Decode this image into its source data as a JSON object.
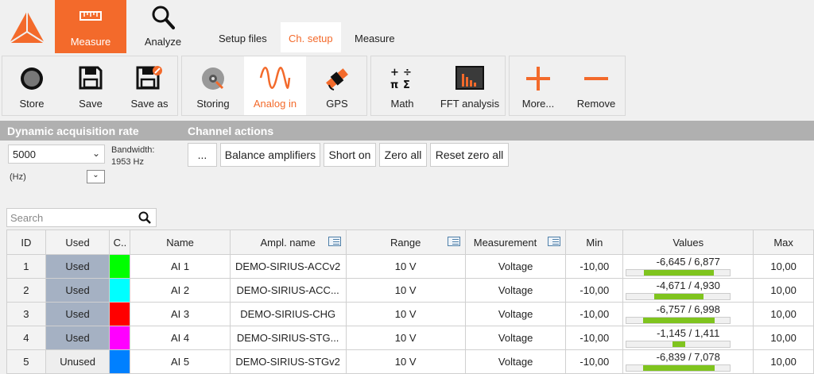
{
  "colors": {
    "accent": "#f36a2b",
    "used_cell": "#a5b1c3",
    "bar_green": "#7fc41e",
    "header_grey": "#b0b0b0"
  },
  "top": {
    "modes": [
      {
        "label": "Measure",
        "icon": "ruler-icon"
      },
      {
        "label": "Analyze",
        "icon": "magnifier-icon"
      }
    ],
    "subtabs": [
      {
        "label": "Setup files"
      },
      {
        "label": "Ch. setup"
      },
      {
        "label": "Measure"
      }
    ]
  },
  "ribbon": {
    "items": [
      {
        "label": "Store",
        "icon": "record-icon"
      },
      {
        "label": "Save",
        "icon": "floppy-icon"
      },
      {
        "label": "Save as",
        "icon": "floppy-edit-icon"
      },
      {
        "label": "Storing",
        "icon": "disk-icon"
      },
      {
        "label": "Analog in",
        "icon": "sine-wave-icon"
      },
      {
        "label": "GPS",
        "icon": "satellite-icon"
      },
      {
        "label": "Math",
        "icon": "math-icon"
      },
      {
        "label": "FFT analysis",
        "icon": "fft-icon"
      },
      {
        "label": "More...",
        "icon": "plus-icon"
      },
      {
        "label": "Remove",
        "icon": "minus-icon"
      }
    ]
  },
  "acquisition": {
    "title": "Dynamic acquisition rate",
    "rate": "5000",
    "unit": "(Hz)",
    "bandwidth_label": "Bandwidth:",
    "bandwidth_value": "1953 Hz"
  },
  "channel_actions": {
    "title": "Channel actions",
    "buttons": [
      "...",
      "Balance amplifiers",
      "Short on",
      "Zero all",
      "Reset zero all"
    ]
  },
  "search": {
    "placeholder": "Search"
  },
  "table": {
    "headers": [
      "ID",
      "Used",
      "C..",
      "Name",
      "Ampl. name",
      "Range",
      "Measurement",
      "Min",
      "Values",
      "Max"
    ],
    "rows": [
      {
        "id": "1",
        "used": "Used",
        "color": "#00ff00",
        "name": "AI 1",
        "ampl": "DEMO-SIRIUS-ACCv2",
        "range": "10 V",
        "measurement": "Voltage",
        "min": "-10,00",
        "values": "-6,645 / 6,877",
        "bar_from": -6.645,
        "bar_to": 6.877,
        "max": "10,00"
      },
      {
        "id": "2",
        "used": "Used",
        "color": "#00ffff",
        "name": "AI 2",
        "ampl": "DEMO-SIRIUS-ACC...",
        "range": "10 V",
        "measurement": "Voltage",
        "min": "-10,00",
        "values": "-4,671 / 4,930",
        "bar_from": -4.671,
        "bar_to": 4.93,
        "max": "10,00"
      },
      {
        "id": "3",
        "used": "Used",
        "color": "#ff0000",
        "name": "AI 3",
        "ampl": "DEMO-SIRIUS-CHG",
        "range": "10 V",
        "measurement": "Voltage",
        "min": "-10,00",
        "values": "-6,757 / 6,998",
        "bar_from": -6.757,
        "bar_to": 6.998,
        "max": "10,00"
      },
      {
        "id": "4",
        "used": "Used",
        "color": "#ff00ff",
        "name": "AI 4",
        "ampl": "DEMO-SIRIUS-STG...",
        "range": "10 V",
        "measurement": "Voltage",
        "min": "-10,00",
        "values": "-1,145 / 1,411",
        "bar_from": -1.145,
        "bar_to": 1.411,
        "max": "10,00"
      },
      {
        "id": "5",
        "used": "Unused",
        "color": "#0080ff",
        "name": "AI 5",
        "ampl": "DEMO-SIRIUS-STGv2",
        "range": "10 V",
        "measurement": "Voltage",
        "min": "-10,00",
        "values": "-6,839 / 7,078",
        "bar_from": -6.839,
        "bar_to": 7.078,
        "max": "10,00"
      }
    ]
  }
}
